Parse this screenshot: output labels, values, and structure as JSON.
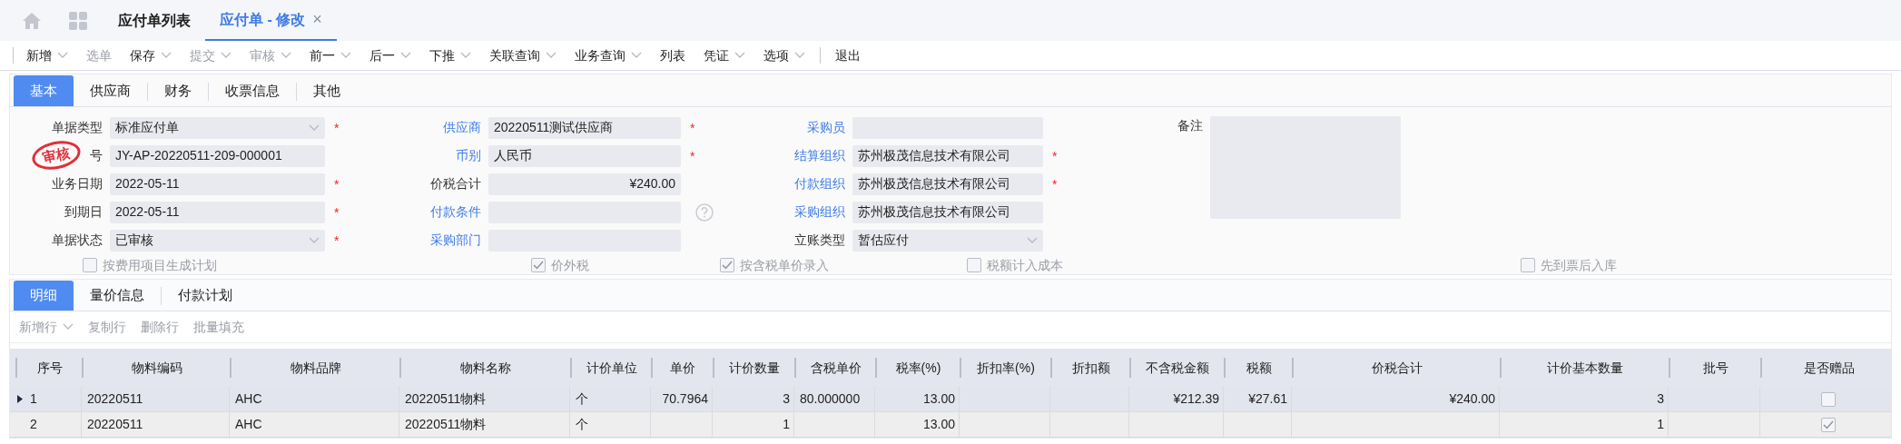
{
  "top_tabs": [
    {
      "label": "应付单列表",
      "selected": false
    },
    {
      "label": "应付单 - 修改",
      "selected": true,
      "close": "×"
    }
  ],
  "toolbar": [
    {
      "label": "新增",
      "disabled": false,
      "caret": true
    },
    {
      "label": "选单",
      "disabled": true,
      "caret": false
    },
    {
      "label": "保存",
      "disabled": false,
      "caret": true
    },
    {
      "label": "提交",
      "disabled": true,
      "caret": true
    },
    {
      "label": "审核",
      "disabled": true,
      "caret": true
    },
    {
      "label": "前一",
      "disabled": false,
      "caret": true
    },
    {
      "label": "后一",
      "disabled": false,
      "caret": true
    },
    {
      "label": "下推",
      "disabled": false,
      "caret": true
    },
    {
      "label": "关联查询",
      "disabled": false,
      "caret": true
    },
    {
      "label": "业务查询",
      "disabled": false,
      "caret": true
    },
    {
      "label": "列表",
      "disabled": false,
      "caret": false
    },
    {
      "label": "凭证",
      "disabled": false,
      "caret": true
    },
    {
      "label": "选项",
      "disabled": false,
      "caret": true
    },
    {
      "label": "退出",
      "disabled": false,
      "caret": false,
      "separated": true
    }
  ],
  "form_tabs": [
    {
      "label": "基本",
      "selected": true
    },
    {
      "label": "供应商",
      "selected": false
    },
    {
      "label": "财务",
      "selected": false
    },
    {
      "label": "收票信息",
      "selected": false
    },
    {
      "label": "其他",
      "selected": false
    }
  ],
  "stamp": "审核",
  "form_columns": [
    [
      {
        "label": "单据类型",
        "link": false,
        "value": "标准应付单",
        "kind": "dropdown",
        "required_mark": "*"
      },
      {
        "label": "号",
        "link": false,
        "value": "JY-AP-20220511-209-000001",
        "kind": "text"
      },
      {
        "label": "业务日期",
        "link": false,
        "value": "2022-05-11",
        "kind": "text",
        "required_mark": "*"
      },
      {
        "label": "到期日",
        "link": false,
        "value": "2022-05-11",
        "kind": "text",
        "required_mark": "*"
      },
      {
        "label": "单据状态",
        "link": false,
        "value": "已审核",
        "kind": "dropdown",
        "required_mark": "*"
      }
    ],
    [
      {
        "label": "供应商",
        "link": true,
        "value": "20220511测试供应商",
        "kind": "text",
        "required_mark": "*"
      },
      {
        "label": "币别",
        "link": true,
        "value": "人民币",
        "kind": "text",
        "required_mark": "*"
      },
      {
        "label": "价税合计",
        "link": false,
        "value": "¥240.00",
        "kind": "amount"
      },
      {
        "label": "付款条件",
        "link": true,
        "kind": "text",
        "help": true
      },
      {
        "label": "采购部门",
        "link": true,
        "kind": "text"
      }
    ],
    [
      {
        "label": "采购员",
        "link": true,
        "kind": "text"
      },
      {
        "label": "结算组织",
        "link": true,
        "value": "苏州极茂信息技术有限公司",
        "kind": "text",
        "required_mark": "*"
      },
      {
        "label": "付款组织",
        "link": true,
        "value": "苏州极茂信息技术有限公司",
        "kind": "text",
        "required_mark": "*"
      },
      {
        "label": "采购组织",
        "link": true,
        "value": "苏州极茂信息技术有限公司",
        "kind": "text"
      },
      {
        "label": "立账类型",
        "link": false,
        "value": "暂估应付",
        "kind": "dropdown"
      }
    ]
  ],
  "note": {
    "label": "备注"
  },
  "options": [
    {
      "label": "按费用项目生成计划",
      "checked": false
    },
    {
      "label": "价外税",
      "checked": true
    },
    {
      "label": "按含税单价录入",
      "checked": true
    },
    {
      "label": "税额计入成本",
      "checked": false
    },
    {
      "label": "先到票后入库",
      "checked": false
    }
  ],
  "detail_tabs": [
    {
      "label": "明细",
      "selected": true
    },
    {
      "label": "量价信息",
      "selected": false
    },
    {
      "label": "付款计划",
      "selected": false
    }
  ],
  "detail_toolbar": [
    {
      "label": "新增行",
      "caret": true
    },
    {
      "label": "复制行",
      "caret": false
    },
    {
      "label": "删除行",
      "caret": false
    },
    {
      "label": "批量填充",
      "caret": false
    }
  ],
  "table": {
    "columns": [
      "序号",
      "物料编码",
      "物料品牌",
      "物料名称",
      "计价单位",
      "单价",
      "计价数量",
      "含税单价",
      "税率(%)",
      "折扣率(%)",
      "折扣额",
      "不含税金额",
      "税额",
      "价税合计",
      "计价基本数量",
      "批号",
      "是否赠品"
    ],
    "rows": [
      {
        "selected": true,
        "cells": [
          "1",
          "20220511",
          "AHC",
          "20220511物料",
          "个",
          "70.7964",
          "3",
          "80.000000",
          "13.00",
          null,
          null,
          "¥212.39",
          "¥27.61",
          "¥240.00",
          "3",
          null
        ],
        "gift": false
      },
      {
        "selected": false,
        "cells": [
          "2",
          "20220511",
          "AHC",
          "20220511物料",
          "个",
          null,
          "1",
          null,
          "13.00",
          null,
          null,
          null,
          null,
          null,
          "1",
          null
        ],
        "gift": true
      }
    ]
  }
}
